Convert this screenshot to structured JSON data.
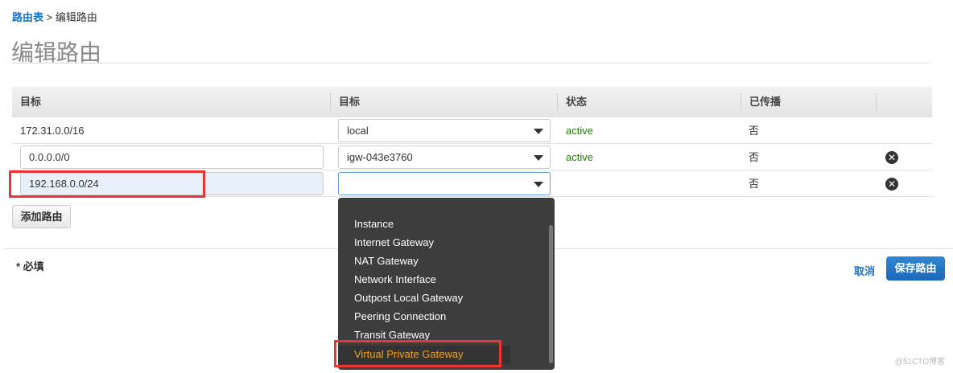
{
  "breadcrumb": {
    "parent": "路由表",
    "sep": " > ",
    "current": "编辑路由"
  },
  "page_title": "编辑路由",
  "table": {
    "headers": [
      "目标",
      "目标",
      "状态",
      "已传播"
    ],
    "rows": [
      {
        "destination": "172.31.0.0/16",
        "target": "local",
        "status": "active",
        "propagated": "否"
      },
      {
        "destination": "0.0.0.0/0",
        "target": "igw-043e3760",
        "status": "active",
        "propagated": "否"
      },
      {
        "destination": "192.168.0.0/24",
        "target": "",
        "status": "",
        "propagated": "否"
      }
    ]
  },
  "add_route": "添加路由",
  "required_note": "* 必填",
  "cancel": "取消",
  "save": "保存路由",
  "dropdown": {
    "options": [
      "Instance",
      "Internet Gateway",
      "NAT Gateway",
      "Network Interface",
      "Outpost Local Gateway",
      "Peering Connection",
      "Transit Gateway",
      "Virtual Private Gateway"
    ],
    "highlighted": "Virtual Private Gateway"
  },
  "watermark": "@51CTO博客",
  "colors": {
    "link": "#1a73c9",
    "active": "#1d8102",
    "highlight": "#f0a020",
    "annotation": "#ee3333"
  }
}
